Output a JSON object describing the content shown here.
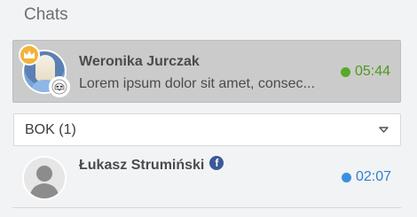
{
  "section": {
    "title": "Chats"
  },
  "active_chat": {
    "name": "Weronika Jurczak",
    "preview": "Lorem ipsum dolor sit amet, consec...",
    "time": "05:44",
    "status_color": "#58a82a",
    "badge_icon": "crown-icon",
    "secondary_avatar_icon": "stormtrooper-avatar-icon"
  },
  "group": {
    "label": "BOK (1)",
    "toggle_icon": "chevron-down-icon"
  },
  "chats": [
    {
      "name": "Łukasz Strumiński",
      "source_icon": "facebook-icon",
      "time": "02:07",
      "status_color": "#3b8fe0"
    }
  ]
}
